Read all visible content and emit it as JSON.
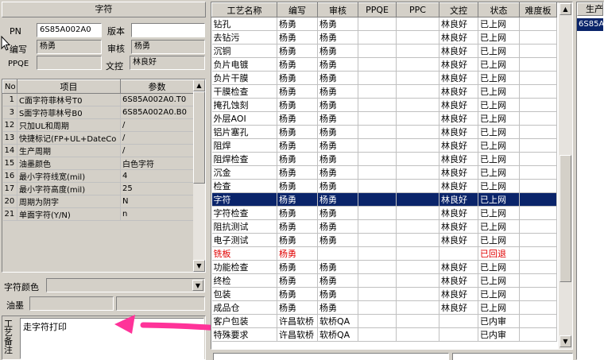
{
  "left": {
    "title": "字符",
    "pn_label": "PN",
    "pn_value": "6S85A002A0",
    "version_label": "版本",
    "version_value": "",
    "writer_label": "编写",
    "writer_value": "杨勇",
    "review_label": "审核",
    "review_value": "杨勇",
    "ppqe_label": "PPQE",
    "ppqe_value": "",
    "ctrl_label": "文控",
    "ctrl_value": "林良好",
    "param_headers": [
      "No",
      "项目",
      "参数"
    ],
    "params": [
      {
        "no": "1",
        "item": "C面字符菲林号T0",
        "value": "6S85A002A0.T0"
      },
      {
        "no": "3",
        "item": "S面字符菲林号B0",
        "value": "6S85A002A0.B0"
      },
      {
        "no": "12",
        "item": "只加UL和周期",
        "value": "/"
      },
      {
        "no": "13",
        "item": "快捷标记(FP+UL+DateCo",
        "value": "/"
      },
      {
        "no": "14",
        "item": "生产周期",
        "value": "/"
      },
      {
        "no": "15",
        "item": "油墨颜色",
        "value": "白色字符"
      },
      {
        "no": "16",
        "item": "最小字符线宽(mil)",
        "value": "4"
      },
      {
        "no": "17",
        "item": "最小字符高度(mil)",
        "value": "25"
      },
      {
        "no": "20",
        "item": "周期为阴字",
        "value": "N"
      },
      {
        "no": "21",
        "item": "单面字符(Y/N)",
        "value": "n"
      }
    ],
    "char_color_label": "字符颜色",
    "char_color_value": "",
    "ink_label": "油墨",
    "ink_value1": "",
    "ink_value2": "",
    "notes_label": "工艺备注",
    "notes_value": "走字符打印"
  },
  "grid": {
    "headers": [
      "工艺名称",
      "编写",
      "审核",
      "PPQE",
      "PPC",
      "文控",
      "状态",
      "难度板"
    ],
    "selected_index": 14,
    "red_index": 18,
    "rows": [
      [
        "钻孔",
        "杨勇",
        "杨勇",
        "",
        "",
        "林良好",
        "已上网",
        ""
      ],
      [
        "去钻污",
        "杨勇",
        "杨勇",
        "",
        "",
        "林良好",
        "已上网",
        ""
      ],
      [
        "沉铜",
        "杨勇",
        "杨勇",
        "",
        "",
        "林良好",
        "已上网",
        ""
      ],
      [
        "负片电镀",
        "杨勇",
        "杨勇",
        "",
        "",
        "林良好",
        "已上网",
        ""
      ],
      [
        "负片干膜",
        "杨勇",
        "杨勇",
        "",
        "",
        "林良好",
        "已上网",
        ""
      ],
      [
        "干膜检查",
        "杨勇",
        "杨勇",
        "",
        "",
        "林良好",
        "已上网",
        ""
      ],
      [
        "掩孔蚀刻",
        "杨勇",
        "杨勇",
        "",
        "",
        "林良好",
        "已上网",
        ""
      ],
      [
        "外层AOI",
        "杨勇",
        "杨勇",
        "",
        "",
        "林良好",
        "已上网",
        ""
      ],
      [
        "铝片塞孔",
        "杨勇",
        "杨勇",
        "",
        "",
        "林良好",
        "已上网",
        ""
      ],
      [
        "阻焊",
        "杨勇",
        "杨勇",
        "",
        "",
        "林良好",
        "已上网",
        ""
      ],
      [
        "阻焊检查",
        "杨勇",
        "杨勇",
        "",
        "",
        "林良好",
        "已上网",
        ""
      ],
      [
        "沉金",
        "杨勇",
        "杨勇",
        "",
        "",
        "林良好",
        "已上网",
        ""
      ],
      [
        "检查",
        "杨勇",
        "杨勇",
        "",
        "",
        "林良好",
        "已上网",
        ""
      ],
      [
        "字符",
        "杨勇",
        "杨勇",
        "",
        "",
        "林良好",
        "已上网",
        ""
      ],
      [
        "字符检查",
        "杨勇",
        "杨勇",
        "",
        "",
        "林良好",
        "已上网",
        ""
      ],
      [
        "阻抗测试",
        "杨勇",
        "杨勇",
        "",
        "",
        "林良好",
        "已上网",
        ""
      ],
      [
        "电子测试",
        "杨勇",
        "杨勇",
        "",
        "",
        "林良好",
        "已上网",
        ""
      ],
      [
        "铣板",
        "杨勇",
        "",
        "",
        "",
        "",
        "已回退",
        ""
      ],
      [
        "功能检查",
        "杨勇",
        "杨勇",
        "",
        "",
        "林良好",
        "已上网",
        ""
      ],
      [
        "终检",
        "杨勇",
        "杨勇",
        "",
        "",
        "林良好",
        "已上网",
        ""
      ],
      [
        "包装",
        "杨勇",
        "杨勇",
        "",
        "",
        "林良好",
        "已上网",
        ""
      ],
      [
        "成品仓",
        "杨勇",
        "杨勇",
        "",
        "",
        "林良好",
        "已上网",
        ""
      ],
      [
        "客户包装",
        "许昌软桥",
        "软桥QA",
        "",
        "",
        "",
        "已内审",
        ""
      ],
      [
        "特殊要求",
        "许昌软桥",
        "软桥QA",
        "",
        "",
        "",
        "已内审",
        ""
      ]
    ]
  },
  "right": {
    "header": "生产",
    "item": "6S85A00"
  },
  "colors": {
    "selection": "#0a246a",
    "rolled_back": "#e00000",
    "arrow": "#ff3399"
  }
}
